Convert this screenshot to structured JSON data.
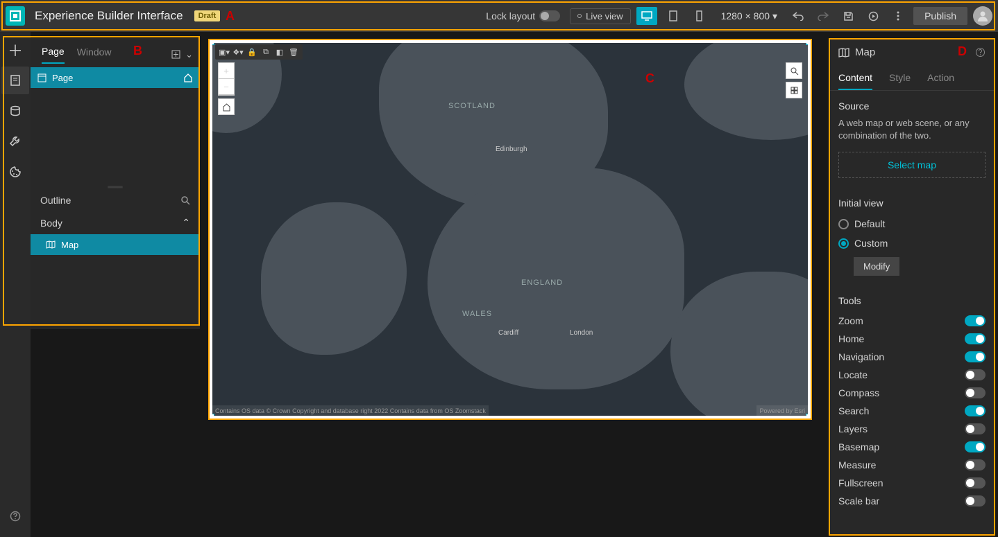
{
  "header": {
    "title": "Experience Builder Interface",
    "badge": "Draft",
    "lock_layout": "Lock layout",
    "live_view": "Live view",
    "resolution": "1280 × 800",
    "publish": "Publish"
  },
  "left_panel": {
    "tabs": [
      "Page",
      "Window"
    ],
    "page_item": "Page",
    "outline": "Outline",
    "body": "Body",
    "map_item": "Map"
  },
  "canvas": {
    "labels": {
      "scotland": "SCOTLAND",
      "england": "ENGLAND",
      "wales": "WALES"
    },
    "cities": {
      "edinburgh": "Edinburgh",
      "cardiff": "Cardiff",
      "london": "London"
    },
    "attrib_left": "Contains OS data © Crown Copyright and database right 2022 Contains data from OS Zoomstack",
    "attrib_right": "Powered by Esri"
  },
  "right_panel": {
    "title": "Map",
    "tabs": [
      "Content",
      "Style",
      "Action"
    ],
    "source": {
      "heading": "Source",
      "desc": "A web map or web scene, or any combination of the two.",
      "button": "Select map"
    },
    "initial_view": {
      "heading": "Initial view",
      "default": "Default",
      "custom": "Custom",
      "modify": "Modify"
    },
    "tools": {
      "heading": "Tools",
      "items": [
        {
          "label": "Zoom",
          "on": true
        },
        {
          "label": "Home",
          "on": true
        },
        {
          "label": "Navigation",
          "on": true
        },
        {
          "label": "Locate",
          "on": false
        },
        {
          "label": "Compass",
          "on": false
        },
        {
          "label": "Search",
          "on": true
        },
        {
          "label": "Layers",
          "on": false
        },
        {
          "label": "Basemap",
          "on": true
        },
        {
          "label": "Measure",
          "on": false
        },
        {
          "label": "Fullscreen",
          "on": false
        },
        {
          "label": "Scale bar",
          "on": false
        }
      ]
    }
  },
  "annotations": {
    "A": "A",
    "B": "B",
    "C": "C",
    "D": "D"
  }
}
